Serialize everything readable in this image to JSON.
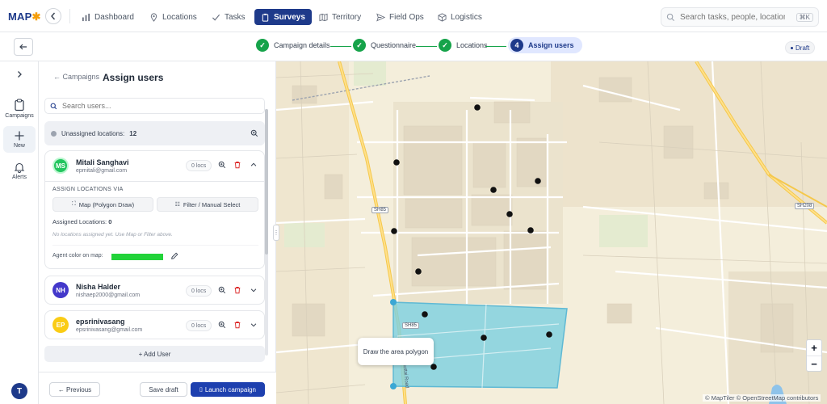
{
  "app": {
    "logo_main": "MAP",
    "logo_accent": "🗺"
  },
  "nav": {
    "items": [
      {
        "label": "Dashboard",
        "icon": "bar-chart-icon"
      },
      {
        "label": "Locations",
        "icon": "map-pin-icon"
      },
      {
        "label": "Tasks",
        "icon": "check-icon"
      },
      {
        "label": "Surveys",
        "icon": "clipboard-icon",
        "active": true
      },
      {
        "label": "Territory",
        "icon": "map-icon"
      },
      {
        "label": "Field Ops",
        "icon": "send-icon"
      },
      {
        "label": "Logistics",
        "icon": "box-icon"
      }
    ],
    "search_placeholder": "Search tasks, people, locations...",
    "search_shortcut": "⌘K"
  },
  "stepper": {
    "steps": [
      {
        "label": "Campaign details",
        "state": "done"
      },
      {
        "label": "Questionnaire",
        "state": "done"
      },
      {
        "label": "Locations",
        "state": "done"
      },
      {
        "label": "Assign users",
        "state": "current",
        "number": "4"
      }
    ],
    "status_badge": "Draft"
  },
  "rail": {
    "items": [
      {
        "label": "Campaigns",
        "icon": "clipboard-icon"
      },
      {
        "label": "New",
        "icon": "plus-icon",
        "active": true
      },
      {
        "label": "Alerts",
        "icon": "bell-icon"
      }
    ],
    "user_initial": "T"
  },
  "panel": {
    "back_link": "← Campaigns",
    "title": "Assign users",
    "search_placeholder": "Search users...",
    "unassigned_label": "Unassigned locations:",
    "unassigned_count": "12",
    "users": [
      {
        "initials": "MS",
        "name": "Mitali Sanghavi",
        "email": "epmitali@gmail.com",
        "locs": "0 locs",
        "color": "#22c55e",
        "expanded": true,
        "assign_via_label": "ASSIGN LOCATIONS VIA",
        "map_button": "Map (Polygon Draw)",
        "filter_button": "Filter / Manual Select",
        "assigned_label": "Assigned Locations:",
        "assigned_count": "0",
        "empty_note": "No locations assigned yet. Use Map or Filter above.",
        "agent_color_label": "Agent color on map:",
        "agent_color": "#22d33a"
      },
      {
        "initials": "NH",
        "name": "Nisha Halder",
        "email": "nishaep2000@gmail.com",
        "locs": "0 locs",
        "color": "#4338ca"
      },
      {
        "initials": "EP",
        "name": "epsrinivasang",
        "email": "epsrinivasang@gmail.com",
        "locs": "0 locs",
        "color": "#facc15"
      }
    ],
    "add_user_label": "+ Add User",
    "previous_label": "← Previous",
    "save_draft_label": "Save draft",
    "launch_label": "Launch campaign"
  },
  "map": {
    "road_labels": [
      "SH85",
      "SH208",
      "SH85"
    ],
    "street_label": "Rayakottai Road",
    "tooltip": "Draw the area polygon",
    "zoom_in": "+",
    "zoom_out": "−",
    "attribution": "© MapTiler © OpenStreetMap contributors",
    "polygon_color": "#7ccfe0"
  }
}
